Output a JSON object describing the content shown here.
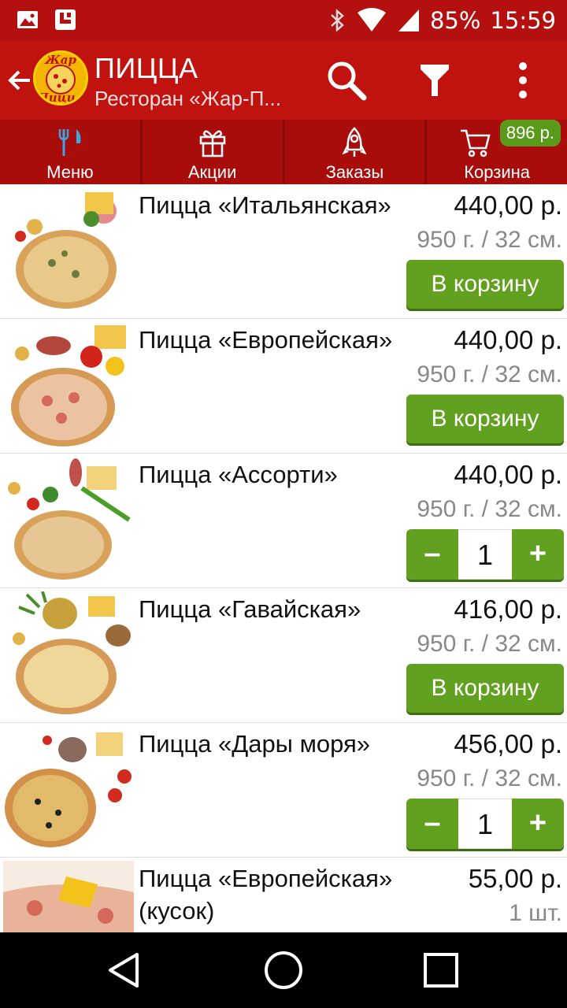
{
  "status_bar": {
    "battery": "85%",
    "time": "15:59"
  },
  "app_bar": {
    "title": "ПИЦЦА",
    "subtitle": "Ресторан «Жар-П...",
    "logo_text_1": "Жар",
    "logo_text_2": "Пицца"
  },
  "tabs": [
    {
      "label": "Меню",
      "icon": "fork-knife-icon"
    },
    {
      "label": "Акции",
      "icon": "gift-icon"
    },
    {
      "label": "Заказы",
      "icon": "rocket-icon"
    },
    {
      "label": "Корзина",
      "icon": "cart-icon",
      "badge": "896 р."
    }
  ],
  "colors": {
    "primary_red": "#c0120f",
    "dark_red": "#b3100f",
    "accent_green": "#62a020"
  },
  "products": [
    {
      "name": "Пицца «Итальянская»",
      "price": "440,00 р.",
      "weight": "950 г. / 32 см.",
      "action": "В корзину"
    },
    {
      "name": "Пицца «Европейская»",
      "price": "440,00 р.",
      "weight": "950 г. / 32 см.",
      "action": "В корзину"
    },
    {
      "name": "Пицца «Ассорти»",
      "price": "440,00 р.",
      "weight": "950 г. / 32 см.",
      "minus": "–",
      "quantity": "1",
      "plus": "+"
    },
    {
      "name": "Пицца «Гавайская»",
      "price": "416,00 р.",
      "weight": "950 г. / 32 см.",
      "action": "В корзину"
    },
    {
      "name": "Пицца «Дары моря»",
      "price": "456,00 р.",
      "weight": "950 г. / 32 см.",
      "minus": "–",
      "quantity": "1",
      "plus": "+"
    },
    {
      "name": "Пицца «Европейская» (кусок)",
      "price": "55,00 р.",
      "weight": "1 шт."
    }
  ]
}
